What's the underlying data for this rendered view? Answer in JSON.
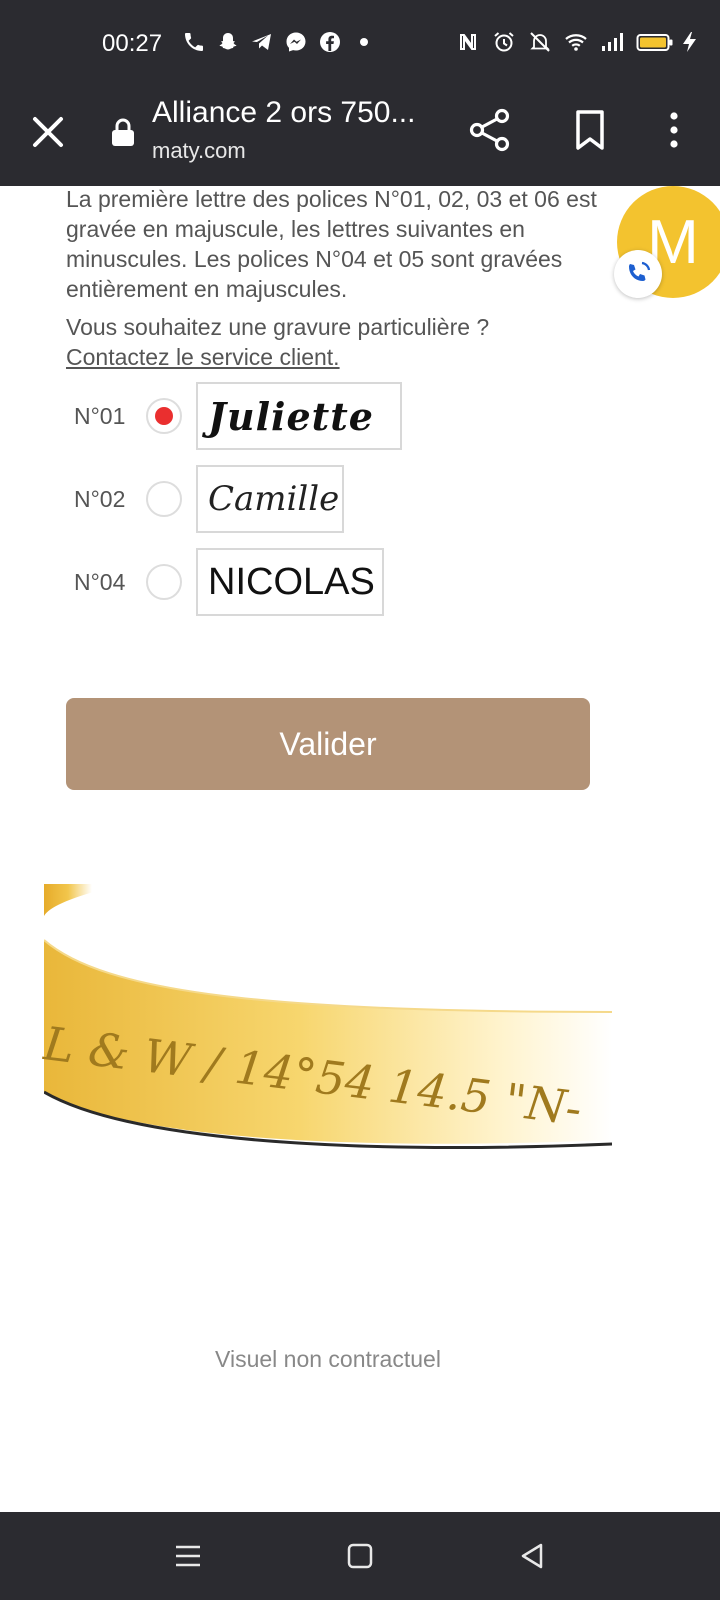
{
  "status_bar": {
    "time": "00:27",
    "left_icons": [
      "phone-icon",
      "snapchat-icon",
      "telegram-icon",
      "messenger-icon",
      "facebook-icon",
      "dot-icon"
    ],
    "right_icons": [
      "nfc-icon",
      "alarm-icon",
      "mute-icon",
      "wifi-icon",
      "signal-icon",
      "battery-icon",
      "charging-icon"
    ]
  },
  "browser": {
    "title": "Alliance 2 ors 750...",
    "domain": "maty.com"
  },
  "content": {
    "description": "La première lettre des polices N°01, 02, 03 et 06 est gravée en majuscule, les lettres suivantes en minuscules. Les polices N°04 et 05 sont gravées entièrement en majuscules.",
    "question": "Vous souhaitez une gravure particulière ?",
    "contact_link": "Contactez le service client.",
    "fonts": [
      {
        "label": "N°01",
        "preview": "Juliette",
        "selected": true
      },
      {
        "label": "N°02",
        "preview": "Camille",
        "selected": false
      },
      {
        "label": "N°04",
        "preview": "NICOLAS",
        "selected": false
      }
    ],
    "validate_label": "Valider",
    "engraving_text": "L & W / 14°54 14.5 \"N-",
    "disclaimer": "Visuel non contractuel"
  },
  "avatar": {
    "letter": "M",
    "color": "#f3c32f"
  },
  "colors": {
    "accent": "#b39377",
    "radio_selected": "#ea2f2f",
    "system_bar": "#2b2b30"
  }
}
